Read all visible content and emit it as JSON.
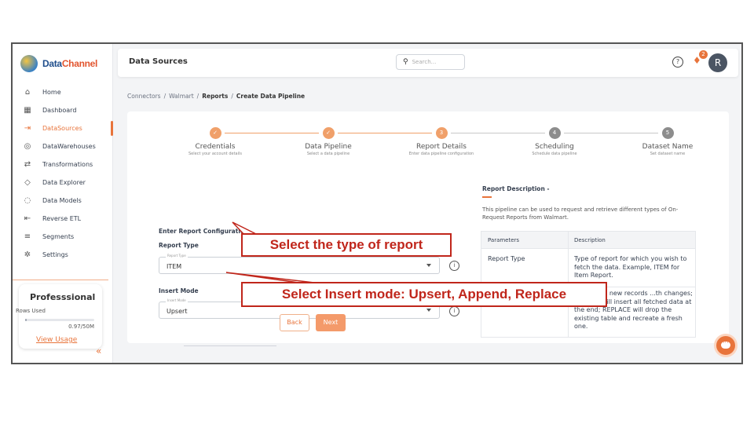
{
  "brand": {
    "logo_part1": "Data",
    "logo_part2": "Channel"
  },
  "sidebar": {
    "items": [
      {
        "label": "Home",
        "icon": "home-icon",
        "glyph": "⌂"
      },
      {
        "label": "Dashboard",
        "icon": "dashboard-icon",
        "glyph": "▦"
      },
      {
        "label": "DataSources",
        "icon": "datasources-icon",
        "glyph": "⇥"
      },
      {
        "label": "DataWarehouses",
        "icon": "database-icon",
        "glyph": "◎"
      },
      {
        "label": "Transformations",
        "icon": "transform-icon",
        "glyph": "⇄"
      },
      {
        "label": "Data Explorer",
        "icon": "explorer-icon",
        "glyph": "◇"
      },
      {
        "label": "Data Models",
        "icon": "models-icon",
        "glyph": "◌"
      },
      {
        "label": "Reverse ETL",
        "icon": "reverse-etl-icon",
        "glyph": "⇤"
      },
      {
        "label": "Segments",
        "icon": "segments-icon",
        "glyph": "≡"
      },
      {
        "label": "Settings",
        "icon": "settings-icon",
        "glyph": "✲"
      }
    ],
    "active_index": 2,
    "plan": {
      "title": "Professsional",
      "rows_label": "Rows Used",
      "usage_value": "0.97/50M",
      "usage_fraction": 0.02,
      "link": "View Usage"
    },
    "collapse_glyph": "«"
  },
  "header": {
    "title": "Data Sources",
    "search_placeholder": "Search...",
    "help_glyph": "?",
    "notification_count": "2",
    "avatar_initial": "R"
  },
  "breadcrumb": {
    "items": [
      "Connectors",
      "Walmart",
      "Reports",
      "Create Data Pipeline"
    ],
    "separator": "/"
  },
  "stepper": {
    "steps": [
      {
        "label": "Credentials",
        "sub": "Select your account details",
        "state": "done",
        "mark": "✓"
      },
      {
        "label": "Data Pipeline",
        "sub": "Select a data pipeline",
        "state": "done",
        "mark": "✓"
      },
      {
        "label": "Report Details",
        "sub": "Enter data pipeline configuration",
        "state": "current",
        "mark": "3"
      },
      {
        "label": "Scheduling",
        "sub": "Schedule data pipeline",
        "state": "todo",
        "mark": "4"
      },
      {
        "label": "Dataset Name",
        "sub": "Set dataset name",
        "state": "todo",
        "mark": "5"
      }
    ]
  },
  "form": {
    "heading": "Enter Report Configuration",
    "report_type": {
      "label": "Report Type",
      "small_label": "Report Type",
      "value": "ITEM"
    },
    "insert_mode": {
      "label": "Insert Mode",
      "small_label": "Insert Mode",
      "value": "Upsert"
    },
    "info_glyph": "i",
    "back": "Back",
    "next": "Next"
  },
  "description": {
    "heading": "Report Description -",
    "text": "This pipeline can be used to request and retrieve different types of On-Request Reports from Walmart.",
    "columns": [
      "Parameters",
      "Description"
    ],
    "rows": [
      {
        "param": "Report Type",
        "desc": "Type of report for which you wish to fetch the data. Example, ITEM for Item Report."
      },
      {
        "param": "",
        "desc": "insert only new records ...th changes; APPEND will insert all fetched data at the end; REPLACE will drop the existing table and recreate a fresh one."
      }
    ]
  },
  "callouts": {
    "report_type": "Select the type of report",
    "insert_mode": "Select Insert mode: Upsert, Append, Replace"
  },
  "colors": {
    "accent": "#e8743b",
    "callout": "#c0261b"
  }
}
